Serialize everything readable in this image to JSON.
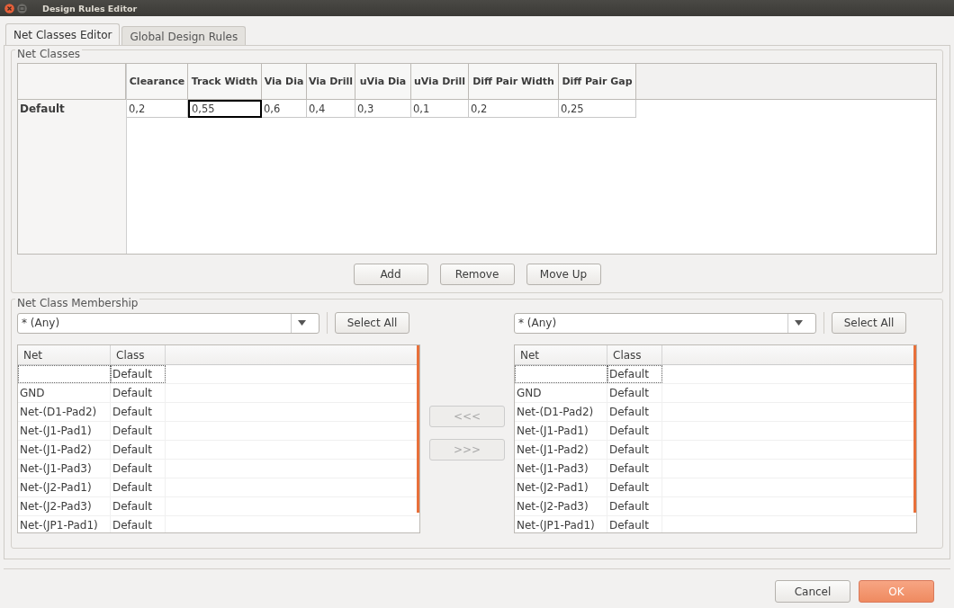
{
  "window": {
    "title": "Design Rules Editor"
  },
  "tabs": [
    {
      "label": "Net Classes Editor",
      "selected": true
    },
    {
      "label": "Global Design Rules",
      "selected": false
    }
  ],
  "net_classes": {
    "title": "Net Classes",
    "columns": [
      "Clearance",
      "Track Width",
      "Via Dia",
      "Via Drill",
      "uVia Dia",
      "uVia Drill",
      "Diff Pair Width",
      "Diff Pair Gap"
    ],
    "rows": [
      {
        "name": "Default",
        "cells": [
          {
            "text": "0,2",
            "selected": false
          },
          {
            "text": "0,55",
            "selected": true
          },
          {
            "text": "0,6",
            "selected": false
          },
          {
            "text": "0,4",
            "selected": false
          },
          {
            "text": "0,3",
            "selected": false
          },
          {
            "text": "0,1",
            "selected": false
          },
          {
            "text": "0,2",
            "selected": false
          },
          {
            "text": "0,25",
            "selected": false
          }
        ]
      }
    ],
    "buttons": [
      "Add",
      "Remove",
      "Move Up"
    ]
  },
  "membership": {
    "title": "Net Class Membership",
    "transfer_buttons": [
      {
        "label": "<<<",
        "disabled": true
      },
      {
        "label": ">>>",
        "disabled": true
      }
    ],
    "panels": [
      {
        "filter": "* (Any)",
        "select_all": "Select All",
        "columns": [
          "Net",
          "Class"
        ],
        "rows": [
          {
            "net": "",
            "class": "Default",
            "focused": true
          },
          {
            "net": "GND",
            "class": "Default",
            "focused": false
          },
          {
            "net": "Net-(D1-Pad2)",
            "class": "Default",
            "focused": false
          },
          {
            "net": "Net-(J1-Pad1)",
            "class": "Default",
            "focused": false
          },
          {
            "net": "Net-(J1-Pad2)",
            "class": "Default",
            "focused": false
          },
          {
            "net": "Net-(J1-Pad3)",
            "class": "Default",
            "focused": false
          },
          {
            "net": "Net-(J2-Pad1)",
            "class": "Default",
            "focused": false
          },
          {
            "net": "Net-(J2-Pad3)",
            "class": "Default",
            "focused": false
          },
          {
            "net": "Net-(JP1-Pad1)",
            "class": "Default",
            "focused": false
          }
        ]
      },
      {
        "filter": "* (Any)",
        "select_all": "Select All",
        "columns": [
          "Net",
          "Class"
        ],
        "rows": [
          {
            "net": "",
            "class": "Default",
            "focused": true
          },
          {
            "net": "GND",
            "class": "Default",
            "focused": false
          },
          {
            "net": "Net-(D1-Pad2)",
            "class": "Default",
            "focused": false
          },
          {
            "net": "Net-(J1-Pad1)",
            "class": "Default",
            "focused": false
          },
          {
            "net": "Net-(J1-Pad2)",
            "class": "Default",
            "focused": false
          },
          {
            "net": "Net-(J1-Pad3)",
            "class": "Default",
            "focused": false
          },
          {
            "net": "Net-(J2-Pad1)",
            "class": "Default",
            "focused": false
          },
          {
            "net": "Net-(J2-Pad3)",
            "class": "Default",
            "focused": false
          },
          {
            "net": "Net-(JP1-Pad1)",
            "class": "Default",
            "focused": false
          }
        ]
      }
    ]
  },
  "dialog_buttons": [
    {
      "label": "Cancel",
      "default": false
    },
    {
      "label": "OK",
      "default": true
    }
  ]
}
